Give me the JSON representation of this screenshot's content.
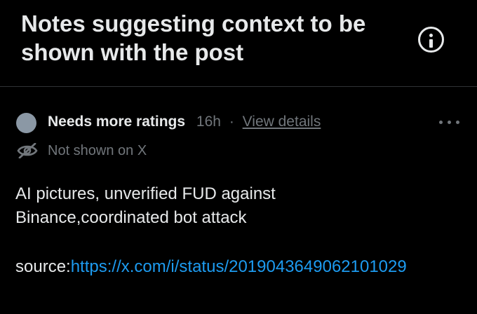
{
  "header": {
    "title": "Notes suggesting context to be shown with the post",
    "info_icon": "info-icon"
  },
  "note": {
    "status_label": "Needs more ratings",
    "time": "16h",
    "separator": "·",
    "view_details_label": "View details",
    "more_icon": "more-horizontal-icon",
    "visibility_icon": "eye-off-icon",
    "visibility_label": "Not shown on X",
    "body_lines": [
      "AI pictures, unverified FUD against",
      "Binance,coordinated bot attack"
    ],
    "source_prefix": "source:",
    "source_url": "https://x.com/i/status/2019043649062101029"
  },
  "colors": {
    "background": "#000000",
    "text_primary": "#e7e9ea",
    "text_muted": "#71767b",
    "status_dot": "#8b98a5",
    "link": "#1d9bf0",
    "divider": "#2f3336"
  }
}
